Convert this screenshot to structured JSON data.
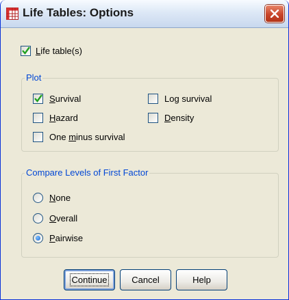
{
  "window": {
    "title": "Life Tables: Options"
  },
  "options": {
    "life_tables": {
      "label_u": "L",
      "label_rest": "ife table(s)",
      "checked": true
    }
  },
  "plot": {
    "legend": "Plot",
    "survival": {
      "label_u": "S",
      "label_rest": "urvival",
      "checked": true
    },
    "log_survival": {
      "label_pre": "Lo",
      "label_u": "g",
      "label_rest": " survival",
      "checked": false
    },
    "hazard": {
      "label_u": "H",
      "label_rest": "azard",
      "checked": false
    },
    "density": {
      "label_u": "D",
      "label_rest": "ensity",
      "checked": false
    },
    "one_minus": {
      "label_pre": "One ",
      "label_u": "m",
      "label_rest": "inus survival",
      "checked": false
    }
  },
  "compare": {
    "legend": "Compare Levels of First Factor",
    "none": {
      "label_u": "N",
      "label_rest": "one",
      "selected": false
    },
    "overall": {
      "label_u": "O",
      "label_rest": "verall",
      "selected": false
    },
    "pairwise": {
      "label_u": "P",
      "label_rest": "airwise",
      "selected": true
    }
  },
  "buttons": {
    "continue": "Continue",
    "cancel": "Cancel",
    "help": "Help"
  }
}
